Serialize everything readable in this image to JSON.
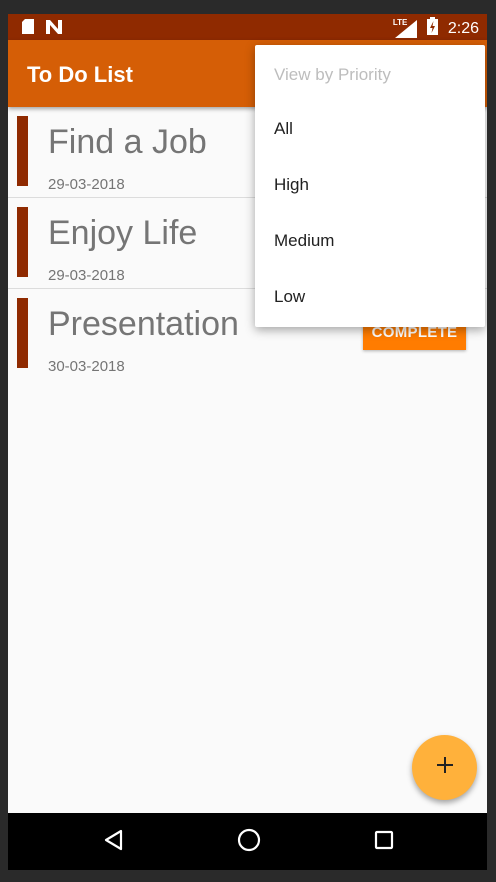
{
  "status_bar": {
    "time": "2:26",
    "network": "LTE",
    "icons": [
      "sd-card-icon",
      "n-notification-icon",
      "signal-icon",
      "battery-charging-icon"
    ]
  },
  "app_bar": {
    "title": "To Do List"
  },
  "tasks": [
    {
      "title": "Find a Job",
      "date": "29-03-2018"
    },
    {
      "title": "Enjoy Life",
      "date": "29-03-2018"
    },
    {
      "title": "Presentation",
      "date": "30-03-2018",
      "action_label": "COMPLETE"
    }
  ],
  "menu": {
    "header": "View by Priority",
    "items": [
      "All",
      "High",
      "Medium",
      "Low"
    ]
  },
  "fab": {
    "icon": "plus-icon"
  },
  "nav": {
    "icons": [
      "back-icon",
      "home-icon",
      "recents-icon"
    ]
  },
  "colors": {
    "status_bar": "#8f2a00",
    "app_bar": "#d55e06",
    "priority_high": "#8f2a00",
    "complete_button": "#ff7c00",
    "fab": "#ffb13b"
  }
}
